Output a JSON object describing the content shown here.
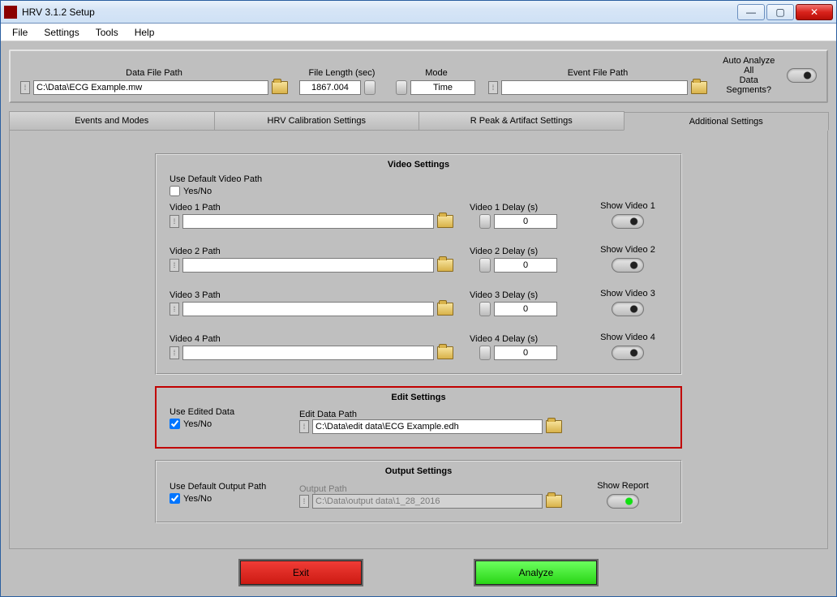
{
  "window": {
    "title": "HRV 3.1.2 Setup"
  },
  "menu": {
    "file": "File",
    "settings": "Settings",
    "tools": "Tools",
    "help": "Help"
  },
  "top": {
    "data_file_label": "Data File Path",
    "data_file_value": "C:\\Data\\ECG Example.mw",
    "file_length_label": "File Length (sec)",
    "file_length_value": "1867.004",
    "mode_label": "Mode",
    "mode_value": "Time",
    "event_file_label": "Event File Path",
    "event_file_value": "",
    "auto_label_line1": "Auto Analyze All",
    "auto_label_line2": "Data Segments?"
  },
  "tabs": {
    "t1": "Events and Modes",
    "t2": "HRV Calibration Settings",
    "t3": "R Peak & Artifact Settings",
    "t4": "Additional Settings"
  },
  "video": {
    "title": "Video Settings",
    "use_default_label": "Use Default Video Path",
    "yesno": "Yes/No",
    "rows": [
      {
        "path_label": "Video 1 Path",
        "path_value": "",
        "delay_label": "Video 1 Delay (s)",
        "delay_value": "0",
        "show_label": "Show Video 1"
      },
      {
        "path_label": "Video 2 Path",
        "path_value": "",
        "delay_label": "Video 2 Delay (s)",
        "delay_value": "0",
        "show_label": "Show Video 2"
      },
      {
        "path_label": "Video 3 Path",
        "path_value": "",
        "delay_label": "Video 3 Delay (s)",
        "delay_value": "0",
        "show_label": "Show Video 3"
      },
      {
        "path_label": "Video 4 Path",
        "path_value": "",
        "delay_label": "Video 4 Delay (s)",
        "delay_value": "0",
        "show_label": "Show Video 4"
      }
    ]
  },
  "edit": {
    "title": "Edit Settings",
    "use_edited_label": "Use Edited Data",
    "yesno": "Yes/No",
    "path_label": "Edit Data Path",
    "path_value": "C:\\Data\\edit data\\ECG Example.edh"
  },
  "output": {
    "title": "Output Settings",
    "use_default_label": "Use Default Output Path",
    "yesno": "Yes/No",
    "path_label": "Output Path",
    "path_value": "C:\\Data\\output data\\1_28_2016",
    "show_label": "Show Report"
  },
  "footer": {
    "exit": "Exit",
    "analyze": "Analyze"
  }
}
